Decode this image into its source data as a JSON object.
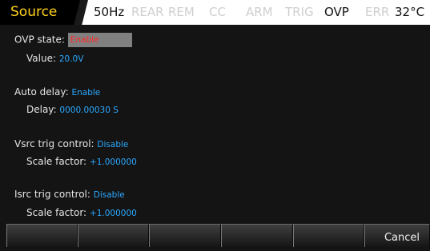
{
  "status_bar": {
    "active_tab": "Source",
    "indicators": [
      {
        "id": "freq",
        "label": "50Hz",
        "active": true
      },
      {
        "id": "rear",
        "label": "REAR",
        "active": false
      },
      {
        "id": "rem",
        "label": "REM",
        "active": false
      },
      {
        "id": "cc",
        "label": "CC",
        "active": false
      },
      {
        "id": "arm",
        "label": "ARM",
        "active": false
      },
      {
        "id": "trig",
        "label": "TRIG",
        "active": false
      },
      {
        "id": "ovp",
        "label": "OVP",
        "active": true
      },
      {
        "id": "err",
        "label": "ERR",
        "active": false
      },
      {
        "id": "temp",
        "label": "32°C",
        "active": true
      }
    ]
  },
  "settings": {
    "ovp_state": {
      "label": "OVP state:",
      "value": "Enable"
    },
    "ovp_value": {
      "label": "Value:",
      "value": "20.0V"
    },
    "auto_delay": {
      "label": "Auto delay:",
      "value": "Enable"
    },
    "delay": {
      "label": "Delay:",
      "value": "0000.00030 S"
    },
    "vsrc_trig_control": {
      "label": "Vsrc trig control:",
      "value": "Disable"
    },
    "vsrc_scale_factor": {
      "label": "Scale factor:",
      "value": "+1.000000"
    },
    "isrc_trig_control": {
      "label": "Isrc trig control:",
      "value": "Disable"
    },
    "isrc_scale_factor": {
      "label": "Scale factor:",
      "value": "+1.000000"
    }
  },
  "softkeys": [
    "",
    "",
    "",
    "",
    "",
    "Cancel"
  ],
  "colors": {
    "tab_text": "#ffd21a",
    "label": "#e6e6e6",
    "value": "#2ba9ff",
    "enable_highlight_text": "#ff2a2a",
    "enable_highlight_bg": "#808080"
  }
}
